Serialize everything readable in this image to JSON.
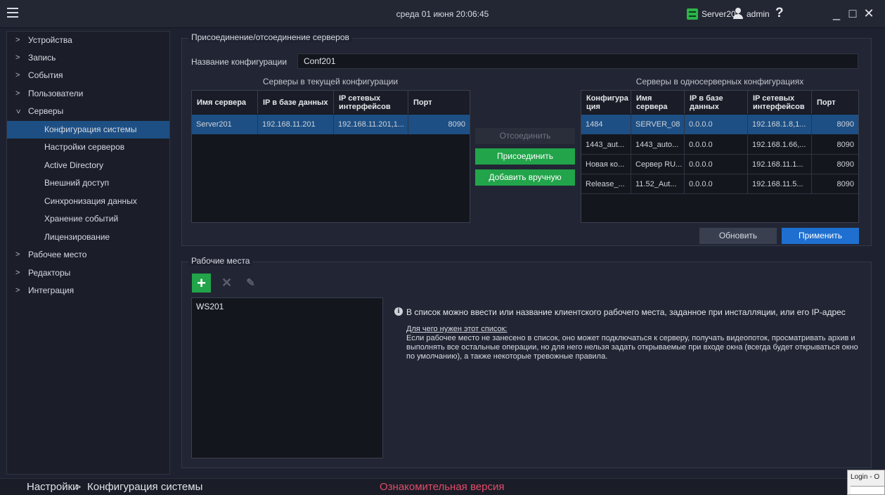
{
  "titlebar": {
    "datetime": "среда 01 июня 20:06:45",
    "server": "Server201",
    "user": "admin",
    "help": "?",
    "minimize": "_",
    "maximize": "□",
    "close": "✕"
  },
  "sidebar": {
    "items": [
      {
        "label": "Устройства"
      },
      {
        "label": "Запись"
      },
      {
        "label": "События"
      },
      {
        "label": "Пользователи"
      },
      {
        "label": "Серверы"
      },
      {
        "label": "Конфигурация системы"
      },
      {
        "label": "Настройки серверов"
      },
      {
        "label": "Active Directory"
      },
      {
        "label": "Внешний доступ"
      },
      {
        "label": "Синхронизация данных"
      },
      {
        "label": "Хранение событий"
      },
      {
        "label": "Лицензирование"
      },
      {
        "label": "Рабочее место"
      },
      {
        "label": "Редакторы"
      },
      {
        "label": "Интеграция"
      }
    ]
  },
  "servers_group": {
    "legend": "Присоединение/отсоединение серверов",
    "config_label": "Название конфигурации",
    "config_value": "Conf201",
    "left_title": "Серверы в текущей конфигурации",
    "right_title": "Серверы в односерверных конфигурациях",
    "left_table": {
      "headers": [
        "Имя сервера",
        "IP в базе данных",
        "IP сетевых интерфейсов",
        "Порт"
      ],
      "rows": [
        [
          "Server201",
          "192.168.11.201",
          "192.168.11.201,1...",
          "8090"
        ]
      ]
    },
    "right_table": {
      "headers": [
        "Конфигура ция",
        "Имя сервера",
        "IP в базе данных",
        "IP сетевых интерфейсов",
        "Порт"
      ],
      "rows": [
        [
          "1484",
          "SERVER_08",
          "0.0.0.0",
          "192.168.1.8,1...",
          "8090"
        ],
        [
          "1443_aut...",
          "1443_auto...",
          "0.0.0.0",
          "192.168.1.66,...",
          "8090"
        ],
        [
          "Новая ко...",
          "Сервер RU...",
          "0.0.0.0",
          "192.168.11.1...",
          "8090"
        ],
        [
          "Release_...",
          "11.52_Aut...",
          "0.0.0.0",
          "192.168.11.5...",
          "8090"
        ]
      ]
    },
    "buttons": {
      "detach": "Отсоединить",
      "attach": "Присоединить",
      "add_manual": "Добавить вручную",
      "refresh": "Обновить",
      "apply": "Применить"
    }
  },
  "workplaces_group": {
    "legend": "Рабочие места",
    "tools": {
      "add": "+",
      "delete": "✕",
      "edit": "✎"
    },
    "items": [
      "WS201"
    ],
    "info_icon": "i",
    "info": "В список можно ввести или название клиентского рабочего места, заданное при инсталляции, или его IP-адрес",
    "why_title": "Для чего нужен этот список:",
    "why_text": "Если рабочее место не занесено в список, оно может подключаться к серверу, получать видеопоток, просматривать архив и выполнять все остальные операции, но для него нельзя задать открываемые при входе окна (всегда будет открываться окно по умолчанию), а также некоторые тревожные правила."
  },
  "statusbar": {
    "crumb_root": "Настройки",
    "crumb_sep": ">",
    "crumb_current": "Конфигурация системы",
    "trial": "Ознакомительная версия"
  },
  "overlay": {
    "login_tab": "Login - O"
  },
  "colors": {
    "background": "#1e2230",
    "accent_selected": "#1d4f84",
    "green_button": "#22a44a",
    "blue_button": "#1e6fd0",
    "trial_text": "#e24c6b"
  }
}
